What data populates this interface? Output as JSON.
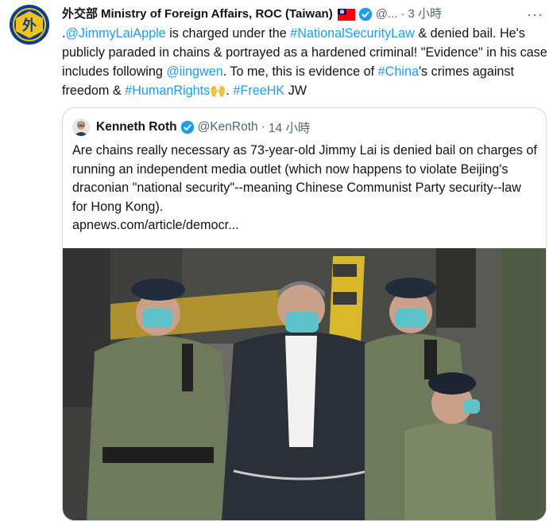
{
  "tweet": {
    "author_cjk": "外交部",
    "author_name": "Ministry of Foreign Affairs, ROC (Taiwan)",
    "handle": "@...",
    "separator": "·",
    "time": "3 小時",
    "more_label": "···",
    "text": {
      "p1": ".",
      "m1": "@JimmyLaiApple",
      "p2": " is charged under the ",
      "h1": "#NationalSecurityLaw",
      "p3": " & denied bail. He's publicly paraded in chains & portrayed as a hardened criminal! \"Evidence\" in his case includes following ",
      "m2": "@iingwen",
      "p4": ". To me, this is evidence of ",
      "h2": "#China",
      "p5": "'s crimes against freedom & ",
      "h3": "#HumanRights",
      "p6": "🙌",
      "p7": ". ",
      "h4": "#FreeHK",
      "p8": " JW"
    }
  },
  "quote": {
    "name": "Kenneth Roth",
    "handle": "@KenRoth",
    "separator": "·",
    "time": "14 小時",
    "text": "Are chains really necessary as 73-year-old Jimmy Lai is denied bail on charges of running an independent media outlet (which now happens to violate Beijing's draconian \"national security\"--meaning Chinese Communist Party security--law for Hong Kong).",
    "url": "apnews.com/article/democr..."
  },
  "icons": {
    "verified": "verified-badge-icon",
    "flag": "taiwan-flag-icon",
    "more": "more-options-icon"
  },
  "colors": {
    "link": "#1d9bf0",
    "secondary_text": "#536471",
    "border": "#cfd9de",
    "uniform": "#6f7a5b"
  }
}
